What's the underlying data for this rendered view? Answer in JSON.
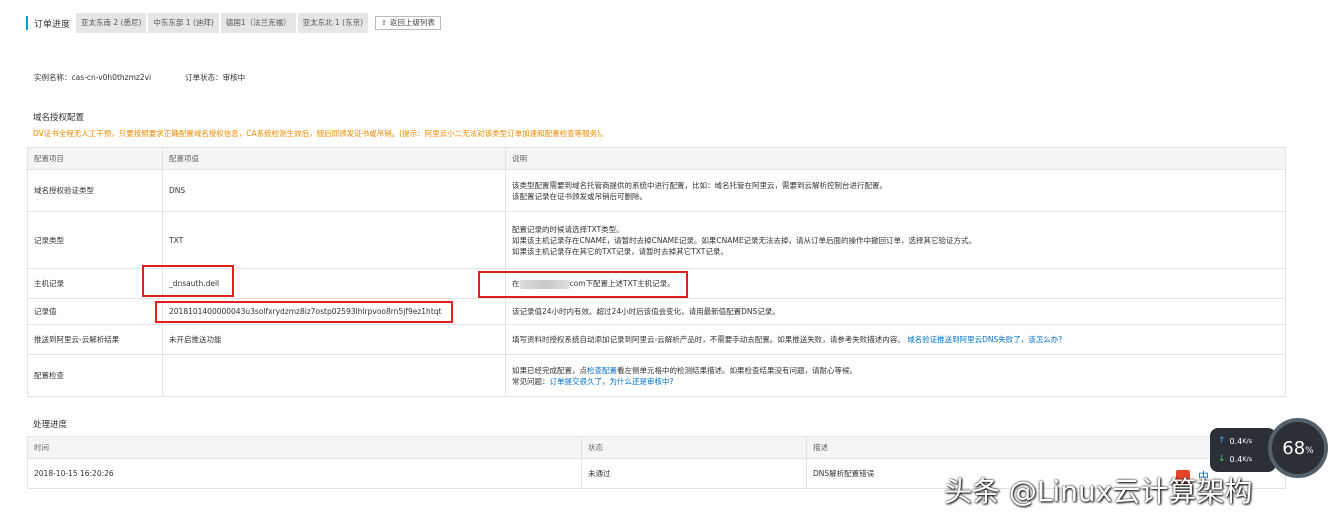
{
  "header": {
    "title": "订单进度",
    "tabs": [
      "亚太东南 2 (悉尼)",
      "中东东部 1 (迪拜)",
      "德国1（法兰克福）",
      "亚太东北 1 (东京)"
    ],
    "back_label": "返回上级列表"
  },
  "meta": {
    "instance": "实例名称：cas-cn-v0h0thzmz2vi",
    "status": "订单状态：审核中"
  },
  "domain_auth": {
    "title": "域名授权配置",
    "warning": "DV证书全程无人工干预，只要按照要求正确配置域名授权信息，CA系统检测生效后，随后即颁发证书或吊销。(提示：阿里云小二无法对该类型订单加速和配置检查等服务)。",
    "headers": [
      "配置项目",
      "配置项值",
      "说明"
    ],
    "rows": [
      {
        "item": "域名授权验证类型",
        "value": "DNS",
        "desc": [
          "该类型配置需要到域名托管商提供的系统中进行配置，比如：域名托管在阿里云，需要到云解析控制台进行配置。",
          "该配置记录在证书颁发或吊销后可删除。"
        ]
      },
      {
        "item": "记录类型",
        "value": "TXT",
        "desc": [
          "配置记录的时候请选择TXT类型。",
          "如果该主机记录存在CNAME，请暂时去掉CNAME记录。如果CNAME记录无法去掉，请从订单后面的操作中撤回订单，选择其它验证方式。",
          "如果该主机记录存在其它的TXT记录，请暂时去掉其它TXT记录。"
        ]
      },
      {
        "item": "主机记录",
        "value": "_dnsauth.dell",
        "desc_prefix": "在",
        "desc_suffix": "com下配置上述TXT主机记录。"
      },
      {
        "item": "记录值",
        "value": "2018101400000043u3solfxrydzmz8iz7ostp02593lhlrpvoo8rn5jf9ez1htqt",
        "desc": [
          "该记录值24小时内有效。超过24小时后该值会变化，请用最新值配置DNS记录。"
        ]
      },
      {
        "item": "推送到阿里云-云解析结果",
        "value": "未开启推送功能",
        "desc_text": "填写资料时授权系统自动添加记录到阿里云-云解析产品时，不需要手动去配置。如果推送失败，请参考失败描述内容。",
        "desc_link": "域名验证推送到阿里云DNS失败了，该怎么办?"
      },
      {
        "item": "配置检查",
        "value": "",
        "desc_a1": "如果已经完成配置，点",
        "desc_a_link": "检查配置",
        "desc_a2": "看左侧单元格中的检测结果描述。如果检查结果没有问题，请耐心等候。",
        "desc_b1": "常见问题：",
        "desc_b_link": "订单提交很久了，为什么还是审核中?"
      }
    ]
  },
  "progress": {
    "title": "处理进度",
    "headers": [
      "时间",
      "状态",
      "描述"
    ],
    "rows": [
      {
        "time": "2018-10-15 16:20:26",
        "status": "未通过",
        "desc": "DNS解析配置错误"
      }
    ]
  },
  "speed_widget": {
    "up": "0.4",
    "down": "0.4",
    "unit": "K/s",
    "percent": "68",
    "percent_sign": "%"
  },
  "watermark": {
    "text": "头条 @Linux云计算架构",
    "partial": "中"
  }
}
